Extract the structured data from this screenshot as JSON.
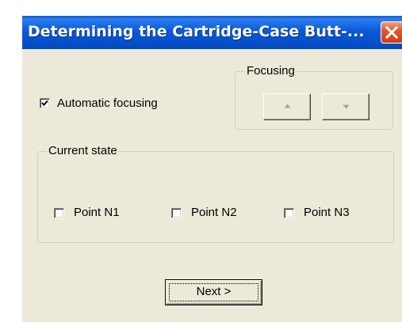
{
  "window": {
    "title": "Determining the Cartridge-Case Butt-...",
    "close_icon": "close-icon"
  },
  "auto_focus": {
    "label": "Automatic focusing",
    "checked": true
  },
  "focusing_group": {
    "caption": "Focusing",
    "up_icon": "triangle-up-icon",
    "down_icon": "triangle-down-icon",
    "enabled": false
  },
  "current_state": {
    "caption": "Current state",
    "points": [
      {
        "label": "Point N1",
        "checked": false
      },
      {
        "label": "Point N2",
        "checked": false
      },
      {
        "label": "Point N3",
        "checked": false
      }
    ]
  },
  "next_button": {
    "label": "Next >"
  },
  "colors": {
    "titlebar": "#0550cc",
    "dialog_bg": "#ece9d8",
    "close_button": "#d23c16",
    "disabled_arrow": "#a6a290"
  }
}
